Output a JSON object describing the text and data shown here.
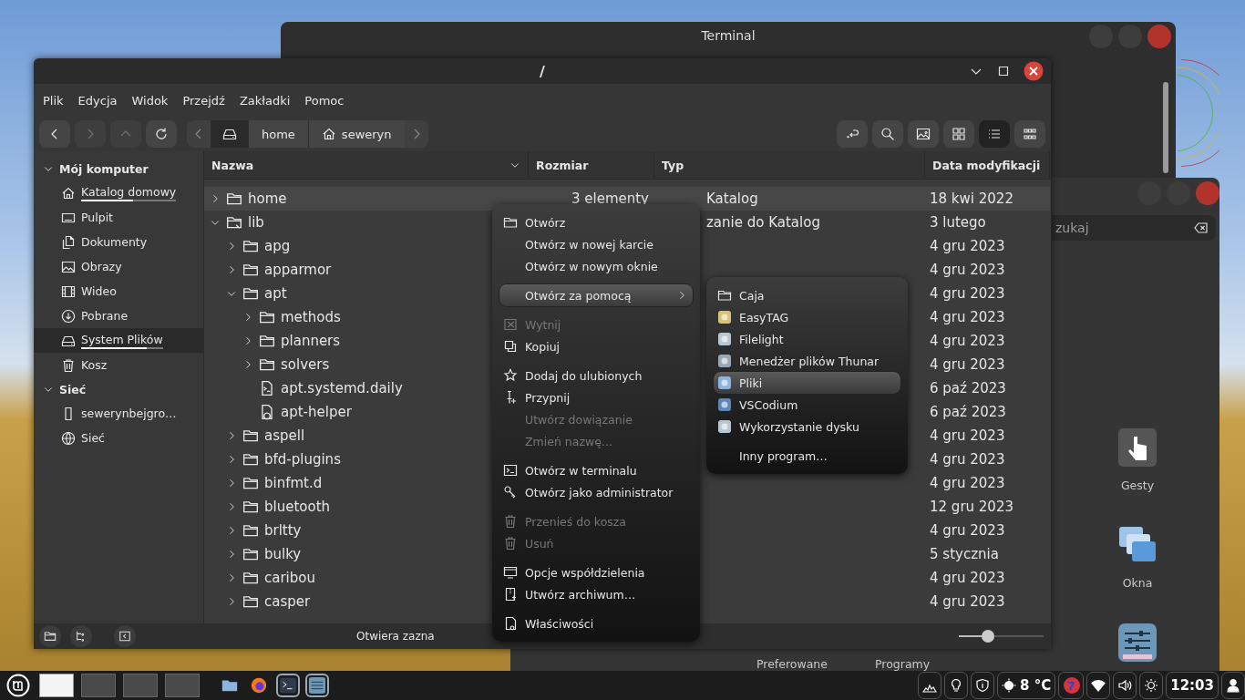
{
  "terminal_window": {
    "title": "Terminal"
  },
  "settings_window": {
    "search": {
      "placeholder": "zukaj"
    },
    "items": [
      {
        "label": "Gesty",
        "kind": "gestures"
      },
      {
        "label": "Okna",
        "kind": "windows"
      },
      {
        "kind": "panel"
      }
    ],
    "bottom_labels": [
      "Preferowane",
      "Programy"
    ]
  },
  "file_manager": {
    "title": "/",
    "menu": [
      "Plik",
      "Edycja",
      "Widok",
      "Przejdź",
      "Zakładki",
      "Pomoc"
    ],
    "toolbar": {
      "nav": [
        {
          "kind": "back",
          "disabled": false
        },
        {
          "kind": "forward",
          "disabled": true
        },
        {
          "kind": "up",
          "disabled": true
        },
        {
          "kind": "reload",
          "disabled": false
        }
      ],
      "breadcrumb": [
        {
          "kind": "drive",
          "selected": true
        },
        {
          "label": "home",
          "selected": false
        },
        {
          "label": "seweryn",
          "kind": "home",
          "selected": false
        }
      ],
      "views": [
        {
          "kind": "location",
          "selected": false
        },
        {
          "kind": "search",
          "selected": false
        },
        {
          "kind": "image",
          "selected": false
        },
        {
          "kind": "grid",
          "selected": false
        },
        {
          "kind": "list",
          "selected": true
        },
        {
          "kind": "compact",
          "selected": false
        }
      ]
    },
    "sidebar": {
      "sections": [
        {
          "title": "Mój komputer",
          "expanded": true,
          "items": [
            {
              "label": "Katalog domowy",
              "kind": "home",
              "selected": false,
              "level": 0.55
            },
            {
              "label": "Pulpit",
              "kind": "desktop",
              "selected": false
            },
            {
              "label": "Dokumenty",
              "kind": "documents",
              "selected": false
            },
            {
              "label": "Obrazy",
              "kind": "pictures",
              "selected": false
            },
            {
              "label": "Wideo",
              "kind": "videos",
              "selected": false
            },
            {
              "label": "Pobrane",
              "kind": "downloads",
              "selected": false
            },
            {
              "label": "System Plików",
              "kind": "drive",
              "selected": true,
              "level": 0.8
            },
            {
              "label": "Kosz",
              "kind": "trash",
              "selected": false
            }
          ]
        },
        {
          "title": "Sieć",
          "expanded": true,
          "items": [
            {
              "label": "sewerynbejgro…",
              "kind": "computer",
              "selected": false
            },
            {
              "label": "Sieć",
              "kind": "network",
              "selected": false
            }
          ]
        }
      ]
    },
    "columns": [
      "Nazwa",
      "Rozmiar",
      "Typ",
      "Data modyfikacji"
    ],
    "rows": [
      {
        "name": "home",
        "kind": "folder",
        "expanded": false,
        "selected": true,
        "size": "3 elementy",
        "type": "Katalog",
        "date": "18 kwi 2022"
      },
      {
        "name": "lib",
        "kind": "link-folder",
        "expanded": true,
        "selected": false,
        "type": "zanie do Katalog",
        "date": "3 lutego",
        "children": [
          {
            "name": "apg",
            "kind": "folder",
            "expanded": false,
            "selected": false,
            "date": "4 gru 2023"
          },
          {
            "name": "apparmor",
            "kind": "folder",
            "expanded": false,
            "selected": false,
            "date": "4 gru 2023"
          },
          {
            "name": "apt",
            "kind": "folder",
            "expanded": true,
            "selected": false,
            "date": "4 gru 2023",
            "children": [
              {
                "name": "methods",
                "kind": "folder",
                "expanded": false,
                "selected": false,
                "date": "4 gru 2023"
              },
              {
                "name": "planners",
                "kind": "folder",
                "expanded": false,
                "selected": false,
                "date": "4 gru 2023"
              },
              {
                "name": "solvers",
                "kind": "folder",
                "expanded": false,
                "selected": false,
                "date": "4 gru 2023"
              },
              {
                "name": "apt.systemd.daily",
                "kind": "script",
                "selected": false,
                "date": "6 paź 2023"
              },
              {
                "name": "apt-helper",
                "kind": "executable",
                "selected": false,
                "date": "6 paź 2023"
              }
            ]
          },
          {
            "name": "aspell",
            "kind": "folder",
            "expanded": false,
            "selected": false,
            "date": "4 gru 2023"
          },
          {
            "name": "bfd-plugins",
            "kind": "folder",
            "expanded": false,
            "selected": false,
            "date": "4 gru 2023"
          },
          {
            "name": "binfmt.d",
            "kind": "folder",
            "expanded": false,
            "selected": false,
            "date": "4 gru 2023"
          },
          {
            "name": "bluetooth",
            "kind": "folder",
            "expanded": false,
            "selected": false,
            "date": "12 gru 2023"
          },
          {
            "name": "brltty",
            "kind": "folder",
            "expanded": false,
            "selected": false,
            "date": "4 gru 2023"
          },
          {
            "name": "bulky",
            "kind": "folder",
            "expanded": false,
            "selected": false,
            "date": "5 stycznia"
          },
          {
            "name": "caribou",
            "kind": "folder",
            "expanded": false,
            "selected": false,
            "date": "4 gru 2023"
          },
          {
            "name": "casper",
            "kind": "folder",
            "expanded": false,
            "selected": false,
            "date": "4 gru 2023"
          }
        ]
      }
    ],
    "status_bar": {
      "text": "Otwiera zazna",
      "zoom": {
        "level": 0.34
      }
    }
  },
  "context_menu": {
    "groups": [
      [
        {
          "label": "Otwórz",
          "kind": "folder",
          "disabled": false,
          "selected": false
        },
        {
          "label": "Otwórz w nowej karcie",
          "kind": "none",
          "disabled": false,
          "selected": false
        },
        {
          "label": "Otwórz w nowym oknie",
          "kind": "none",
          "disabled": false,
          "selected": false
        }
      ],
      [
        {
          "label": "Otwórz za pomocą",
          "kind": "submenu",
          "disabled": false,
          "selected": true
        }
      ],
      [
        {
          "label": "Wytnij",
          "kind": "cut",
          "disabled": true,
          "selected": false
        },
        {
          "label": "Kopiuj",
          "kind": "copy",
          "disabled": false,
          "selected": false
        }
      ],
      [
        {
          "label": "Dodaj do ulubionych",
          "kind": "star",
          "disabled": false,
          "selected": false
        },
        {
          "label": "Przypnij",
          "kind": "pin",
          "disabled": false,
          "selected": false
        },
        {
          "label": "Utwórz dowiązanie",
          "kind": "none",
          "disabled": true,
          "selected": false
        },
        {
          "label": "Zmień nazwę…",
          "kind": "none",
          "disabled": true,
          "selected": false
        }
      ],
      [
        {
          "label": "Otwórz w terminalu",
          "kind": "terminal",
          "disabled": false,
          "selected": false
        },
        {
          "label": "Otwórz jako administrator",
          "kind": "key",
          "disabled": false,
          "selected": false
        }
      ],
      [
        {
          "label": "Przenieś do kosza",
          "kind": "trash",
          "disabled": true,
          "selected": false
        },
        {
          "label": "Usuń",
          "kind": "trash",
          "disabled": true,
          "selected": false
        }
      ],
      [
        {
          "label": "Opcje współdzielenia",
          "kind": "share",
          "disabled": false,
          "selected": false
        },
        {
          "label": "Utwórz archiwum…",
          "kind": "archive",
          "disabled": false,
          "selected": false
        }
      ],
      [
        {
          "label": "Właściwości",
          "kind": "properties",
          "disabled": false,
          "selected": false
        }
      ]
    ]
  },
  "submenu": {
    "groups": [
      [
        {
          "label": "Caja",
          "kind": "folder",
          "selected": false
        },
        {
          "label": "EasyTAG",
          "kind": "tag",
          "selected": false
        },
        {
          "label": "Filelight",
          "kind": "disk",
          "selected": false
        },
        {
          "label": "Menedżer plików Thunar",
          "kind": "hammer",
          "selected": false
        },
        {
          "label": "Pliki",
          "kind": "files",
          "selected": true
        },
        {
          "label": "VSCodium",
          "kind": "code",
          "selected": false
        },
        {
          "label": "Wykorzystanie dysku",
          "kind": "disk",
          "selected": false
        }
      ],
      [
        {
          "label": "Inny program…",
          "kind": "none",
          "selected": false
        }
      ]
    ]
  },
  "taskbar": {
    "workspaces": [
      {
        "selected": true
      },
      {
        "selected": false
      },
      {
        "selected": false
      },
      {
        "selected": false
      }
    ],
    "launchers": [
      {
        "kind": "files",
        "running": false
      },
      {
        "kind": "browser",
        "running": false
      },
      {
        "kind": "terminal",
        "running": true
      },
      {
        "kind": "settings",
        "running": true
      }
    ],
    "tray": [
      {
        "kind": "monitor"
      },
      {
        "kind": "bulb"
      },
      {
        "kind": "shield"
      },
      {
        "kind": "weather",
        "text": "8 °C"
      },
      {
        "kind": "badge",
        "text": "7"
      },
      {
        "kind": "wifi"
      },
      {
        "kind": "volume"
      },
      {
        "kind": "brightness"
      },
      {
        "kind": "clock",
        "text": "12:03"
      },
      {
        "kind": "user"
      }
    ]
  }
}
